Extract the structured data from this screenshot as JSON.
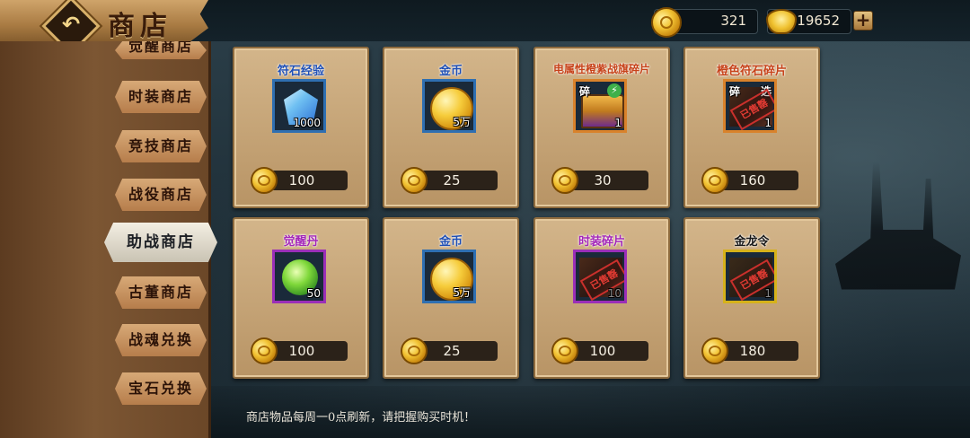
{
  "header": {
    "title": "商店",
    "gold": "321",
    "ingot": "19652",
    "plus_label": "+"
  },
  "sidebar": {
    "items": [
      {
        "label": "觉醒商店",
        "active": false
      },
      {
        "label": "时装商店",
        "active": false
      },
      {
        "label": "竞技商店",
        "active": false
      },
      {
        "label": "战役商店",
        "active": false
      },
      {
        "label": "助战商店",
        "active": true
      },
      {
        "label": "古董商店",
        "active": false
      },
      {
        "label": "战魂兑换",
        "active": false
      },
      {
        "label": "宝石兑换",
        "active": false
      }
    ]
  },
  "items": [
    {
      "name": "符石经验",
      "name_color": "#1f4fb5",
      "count": "1000",
      "price": "100",
      "icon": "blue-crystal-icon",
      "frame": "#2f6fb1"
    },
    {
      "name": "金币",
      "name_color": "#1f4fb5",
      "count": "5万",
      "price": "25",
      "icon": "gold-coin-icon",
      "frame": "#2f6fb1"
    },
    {
      "name": "电属性橙紫战旗碎片",
      "name_color": "#c7431a",
      "count": "1",
      "price": "30",
      "icon": "treasure-chest-icon",
      "frame": "#d9822b",
      "badge": "碎"
    },
    {
      "name": "橙色符石碎片",
      "name_color": "#c7431a",
      "count": "1",
      "price": "160",
      "icon": "rune-fragment-icon",
      "frame": "#d9822b",
      "badge": "碎",
      "badge2": "选",
      "stamp": "已售罄"
    },
    {
      "name": "觉醒丹",
      "name_color": "#a326b8",
      "count": "50",
      "price": "100",
      "icon": "green-orb-icon",
      "frame": "#9b2fb8"
    },
    {
      "name": "金币",
      "name_color": "#1f4fb5",
      "count": "5万",
      "price": "25",
      "icon": "gold-coin-icon",
      "frame": "#2f6fb1"
    },
    {
      "name": "时装碎片",
      "name_color": "#a326b8",
      "count": "10",
      "price": "100",
      "icon": "fashion-fragment-icon",
      "frame": "#9b2fb8",
      "stamp": "已售罄"
    },
    {
      "name": "金龙令",
      "name_color": "#1a1a1a",
      "count": "1",
      "price": "180",
      "icon": "dragon-token-icon",
      "frame": "#d6b21a",
      "stamp": "已售罄"
    }
  ],
  "notice": "商店物品每周一0点刷新，请把握购买时机！"
}
